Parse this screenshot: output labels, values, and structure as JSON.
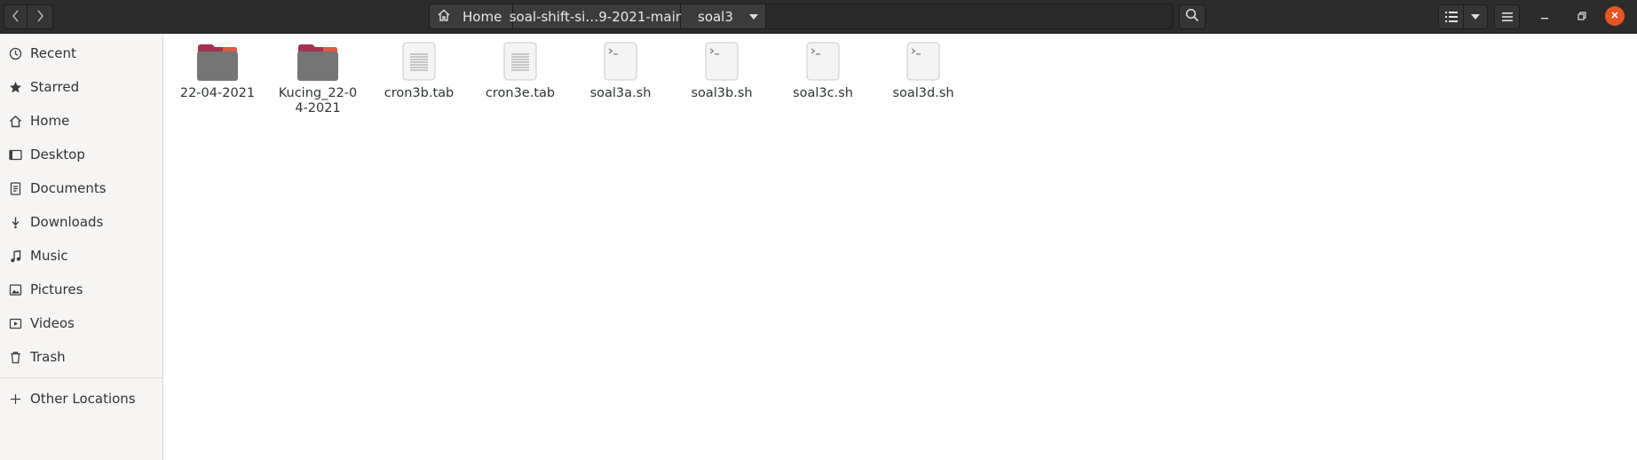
{
  "headerbar": {
    "nav_back_icon": "chevron-left-icon",
    "nav_forward_icon": "chevron-right-icon",
    "path": {
      "home_label": "Home",
      "middle_label": "soal-shift-si…9-2021-main",
      "current_label": "soal3"
    },
    "search_icon": "search-icon",
    "view_icon": "list-view-icon",
    "menu_icon": "hamburger-menu-icon",
    "close_color": "#e95420"
  },
  "sidebar": {
    "items": [
      {
        "label": "Recent",
        "icon": "clock-icon"
      },
      {
        "label": "Starred",
        "icon": "star-icon"
      },
      {
        "label": "Home",
        "icon": "home-icon"
      },
      {
        "label": "Desktop",
        "icon": "desktop-icon"
      },
      {
        "label": "Documents",
        "icon": "document-icon"
      },
      {
        "label": "Downloads",
        "icon": "download-icon"
      },
      {
        "label": "Music",
        "icon": "music-icon"
      },
      {
        "label": "Pictures",
        "icon": "picture-icon"
      },
      {
        "label": "Videos",
        "icon": "video-icon"
      },
      {
        "label": "Trash",
        "icon": "trash-icon"
      }
    ],
    "other_locations": {
      "label": "Other Locations",
      "icon": "plus-icon"
    }
  },
  "files": [
    {
      "name": "22-04-2021",
      "type": "folder"
    },
    {
      "name": "Kucing_22-04-2021",
      "type": "folder"
    },
    {
      "name": "cron3b.tab",
      "type": "text"
    },
    {
      "name": "cron3e.tab",
      "type": "text"
    },
    {
      "name": "soal3a.sh",
      "type": "script"
    },
    {
      "name": "soal3b.sh",
      "type": "script"
    },
    {
      "name": "soal3c.sh",
      "type": "script"
    },
    {
      "name": "soal3d.sh",
      "type": "script"
    }
  ],
  "colors": {
    "folder_tab": "#a5324f",
    "folder_body": "#757575",
    "accent": "#e95420"
  }
}
